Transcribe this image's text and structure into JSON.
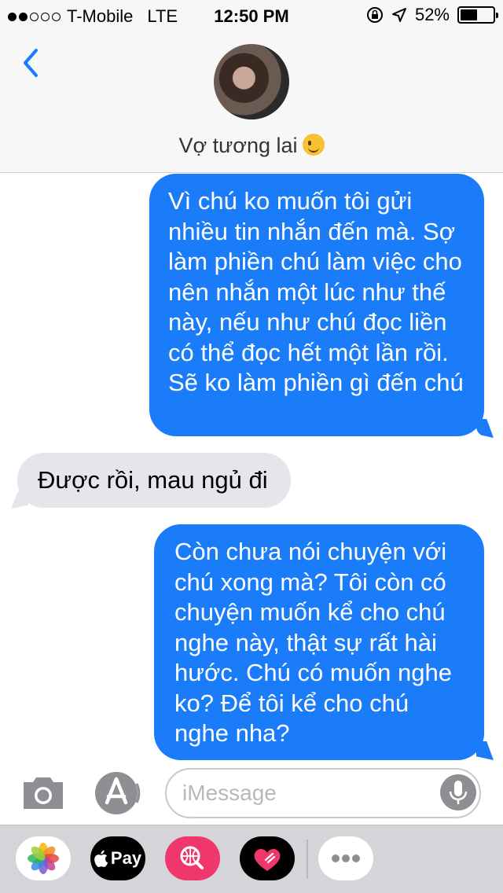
{
  "status_bar": {
    "carrier": "T-Mobile",
    "network": "LTE",
    "time": "12:50 PM",
    "battery": "52%",
    "battery_level": 0.52,
    "signal_bars": 2
  },
  "header": {
    "contact_name": "Vợ tương lai",
    "contact_emoji": "winking-face",
    "back_icon": "chevron-left-icon"
  },
  "messages": [
    {
      "direction": "outgoing",
      "text": "Vì chú ko muốn tôi gửi nhiều tin nhắn đến mà. Sợ làm phiền chú làm việc cho nên nhắn một lúc như thế này, nếu như chú đọc liền có thể đọc hết một lần rồi. Sẽ ko làm phiền gì đến chú"
    },
    {
      "direction": "incoming",
      "text": "Được rồi, mau ngủ đi"
    },
    {
      "direction": "outgoing",
      "text": "Còn chưa nói chuyện với chú xong mà? Tôi còn có chuyện muốn kể cho chú nghe này, thật sự rất hài hước. Chú có muốn nghe ko? Để tôi kể cho chú nghe nha?"
    }
  ],
  "input_bar": {
    "placeholder": "iMessage",
    "value": ""
  },
  "app_drawer": {
    "apple_pay_label": "Pay"
  },
  "colors": {
    "outgoing_bubble": "#1a7cf9",
    "incoming_bubble": "#e6e5eb",
    "accent": "#147efb"
  }
}
